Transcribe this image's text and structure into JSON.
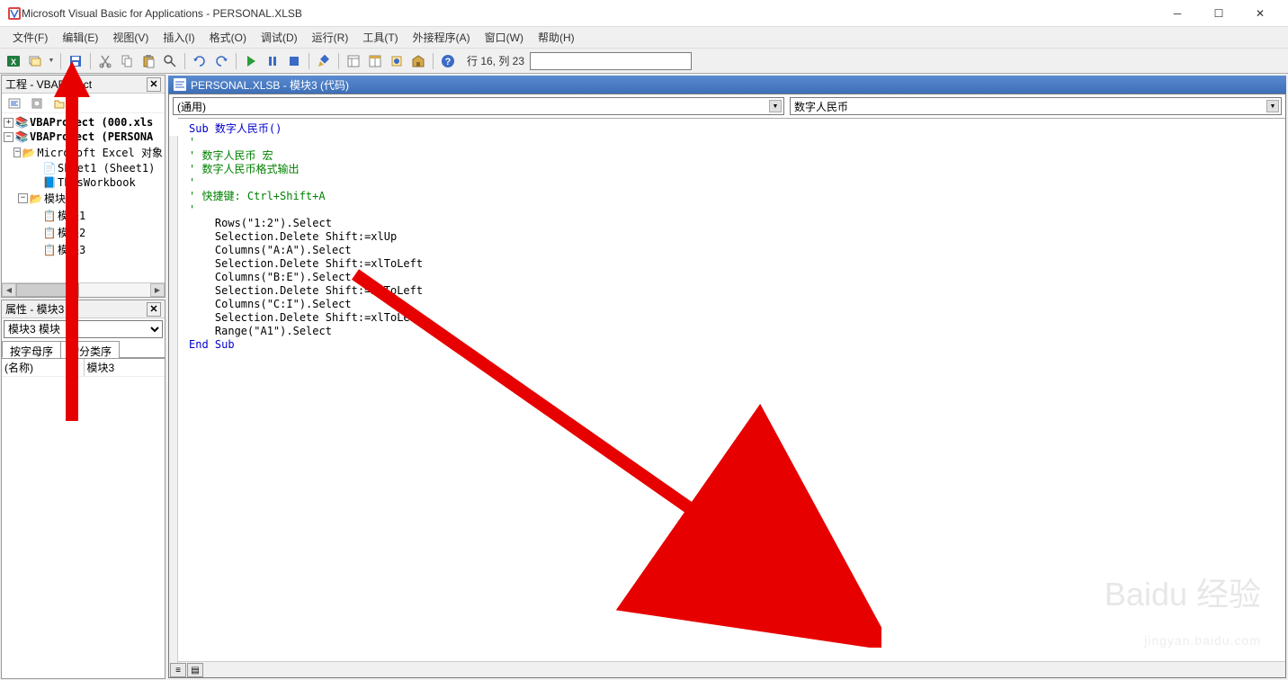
{
  "window": {
    "title": "Microsoft Visual Basic for Applications - PERSONAL.XLSB"
  },
  "menu": {
    "file": "文件(F)",
    "edit": "编辑(E)",
    "view": "视图(V)",
    "insert": "插入(I)",
    "format": "格式(O)",
    "debug": "调试(D)",
    "run": "运行(R)",
    "tools": "工具(T)",
    "addins": "外接程序(A)",
    "window": "窗口(W)",
    "help": "帮助(H)"
  },
  "toolbar": {
    "status": "行 16, 列 23"
  },
  "project_panel": {
    "title": "工程 - VBAProject",
    "nodes": {
      "proj1": "VBAProject (000.xls",
      "proj2": "VBAProject (PERSONA",
      "excel_objs": "Microsoft Excel 对象",
      "sheet1": "Sheet1 (Sheet1)",
      "thiswb": "ThisWorkbook",
      "modules_folder": "模块",
      "mod1": "模块1",
      "mod2": "模块2",
      "mod3": "模块3"
    }
  },
  "prop_panel": {
    "title": "属性 - 模块3",
    "object_select": "模块3 模块",
    "tab_alpha": "按字母序",
    "tab_cat": "按分类序",
    "rows": [
      {
        "k": "(名称)",
        "v": "模块3"
      }
    ]
  },
  "code_window": {
    "title": "PERSONAL.XLSB - 模块3 (代码)",
    "object_dd": "(通用)",
    "proc_dd": "数字人民币",
    "lines": [
      {
        "t": "kw",
        "text": "Sub 数字人民币()"
      },
      {
        "t": "cm",
        "text": "'"
      },
      {
        "t": "cm",
        "text": "' 数字人民币 宏"
      },
      {
        "t": "cm",
        "text": "' 数字人民币格式输出"
      },
      {
        "t": "cm",
        "text": "'"
      },
      {
        "t": "cm",
        "text": "' 快捷键: Ctrl+Shift+A"
      },
      {
        "t": "cm",
        "text": "'"
      },
      {
        "t": "",
        "text": "    Rows(\"1:2\").Select"
      },
      {
        "t": "",
        "text": "    Selection.Delete Shift:=xlUp"
      },
      {
        "t": "",
        "text": "    Columns(\"A:A\").Select"
      },
      {
        "t": "",
        "text": "    Selection.Delete Shift:=xlToLeft"
      },
      {
        "t": "",
        "text": "    Columns(\"B:E\").Select"
      },
      {
        "t": "",
        "text": "    Selection.Delete Shift:=xlToLeft"
      },
      {
        "t": "",
        "text": "    Columns(\"C:I\").Select"
      },
      {
        "t": "",
        "text": "    Selection.Delete Shift:=xlToLeft"
      },
      {
        "t": "",
        "text": "    Range(\"A1\").Select"
      },
      {
        "t": "kw",
        "text": "End Sub"
      }
    ]
  },
  "watermark": {
    "main": "Baidu 经验",
    "sub": "jingyan.baidu.com"
  }
}
